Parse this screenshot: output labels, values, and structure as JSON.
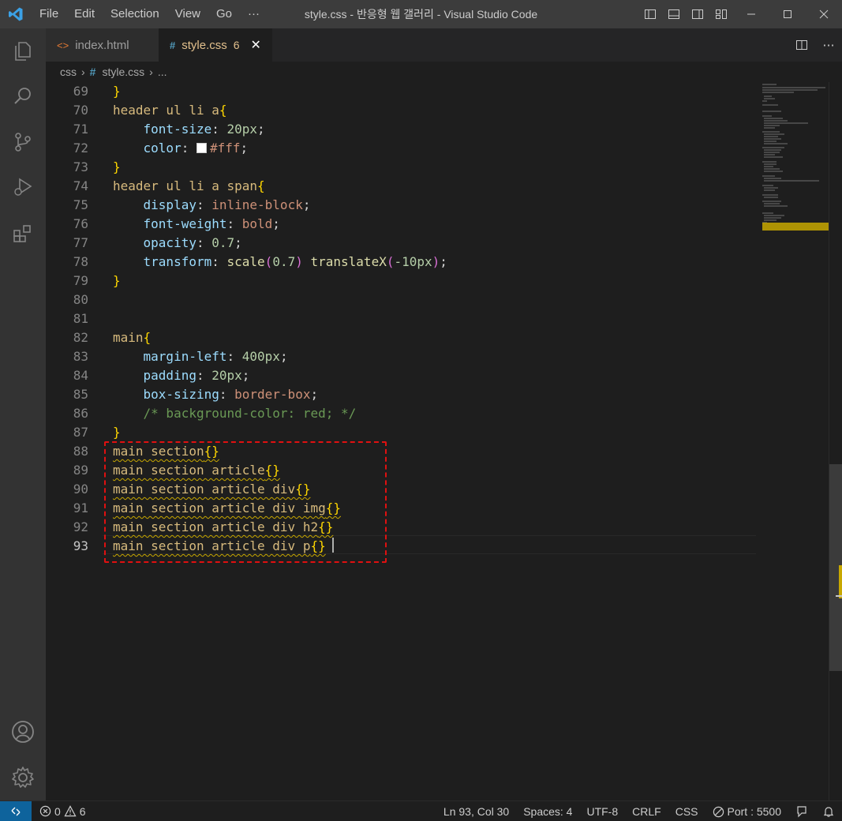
{
  "window": {
    "title": "style.css - 반응형 웹 갤러리 - Visual Studio Code",
    "menu": [
      "File",
      "Edit",
      "Selection",
      "View",
      "Go",
      "···"
    ]
  },
  "tabs": [
    {
      "label": "index.html",
      "icon": "html-icon",
      "active": false
    },
    {
      "label": "style.css",
      "icon": "css-hash-icon",
      "active": true,
      "badge": "6"
    }
  ],
  "breadcrumb": {
    "folder": "css",
    "file": "style.css",
    "more": "..."
  },
  "editor": {
    "lines": [
      {
        "n": "69",
        "text": "}"
      },
      {
        "n": "70",
        "text": "header ul li a{"
      },
      {
        "n": "71",
        "text": "    font-size: 20px;"
      },
      {
        "n": "72",
        "text": "    color: #fff;"
      },
      {
        "n": "73",
        "text": "}"
      },
      {
        "n": "74",
        "text": "header ul li a span{"
      },
      {
        "n": "75",
        "text": "    display: inline-block;"
      },
      {
        "n": "76",
        "text": "    font-weight: bold;"
      },
      {
        "n": "77",
        "text": "    opacity: 0.7;"
      },
      {
        "n": "78",
        "text": "    transform: scale(0.7) translateX(-10px);"
      },
      {
        "n": "79",
        "text": "}"
      },
      {
        "n": "80",
        "text": ""
      },
      {
        "n": "81",
        "text": ""
      },
      {
        "n": "82",
        "text": "main{"
      },
      {
        "n": "83",
        "text": "    margin-left: 400px;"
      },
      {
        "n": "84",
        "text": "    padding: 20px;"
      },
      {
        "n": "85",
        "text": "    box-sizing: border-box;"
      },
      {
        "n": "86",
        "text": "    /* background-color: red; */"
      },
      {
        "n": "87",
        "text": "}"
      },
      {
        "n": "88",
        "text": "main section{}"
      },
      {
        "n": "89",
        "text": "main section article{}"
      },
      {
        "n": "90",
        "text": "main section article div{}"
      },
      {
        "n": "91",
        "text": "main section article div img{}"
      },
      {
        "n": "92",
        "text": "main section article div h2{}"
      },
      {
        "n": "93",
        "text": "main section article div p{}"
      }
    ],
    "current_line": "93"
  },
  "statusbar": {
    "errors": "0",
    "warnings": "6",
    "position": "Ln 93, Col 30",
    "spaces": "Spaces: 4",
    "encoding": "UTF-8",
    "eol": "CRLF",
    "language": "CSS",
    "port": "Port : 5500"
  },
  "colors": {
    "accent": "#0e639c",
    "selector": "#d7ba7d",
    "property": "#9cdcfe",
    "number": "#b5cea8",
    "string_value": "#ce9178",
    "comment": "#6a9955",
    "warning": "#c8a800",
    "highlight_box": "#e01010"
  }
}
